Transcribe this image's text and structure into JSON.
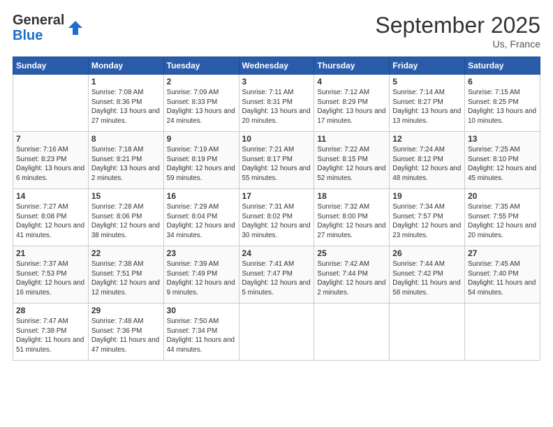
{
  "header": {
    "logo_line1": "General",
    "logo_line2": "Blue",
    "month": "September 2025",
    "location": "Us, France"
  },
  "weekdays": [
    "Sunday",
    "Monday",
    "Tuesday",
    "Wednesday",
    "Thursday",
    "Friday",
    "Saturday"
  ],
  "weeks": [
    [
      {
        "day": "",
        "info": ""
      },
      {
        "day": "1",
        "info": "Sunrise: 7:08 AM\nSunset: 8:36 PM\nDaylight: 13 hours and 27 minutes."
      },
      {
        "day": "2",
        "info": "Sunrise: 7:09 AM\nSunset: 8:33 PM\nDaylight: 13 hours and 24 minutes."
      },
      {
        "day": "3",
        "info": "Sunrise: 7:11 AM\nSunset: 8:31 PM\nDaylight: 13 hours and 20 minutes."
      },
      {
        "day": "4",
        "info": "Sunrise: 7:12 AM\nSunset: 8:29 PM\nDaylight: 13 hours and 17 minutes."
      },
      {
        "day": "5",
        "info": "Sunrise: 7:14 AM\nSunset: 8:27 PM\nDaylight: 13 hours and 13 minutes."
      },
      {
        "day": "6",
        "info": "Sunrise: 7:15 AM\nSunset: 8:25 PM\nDaylight: 13 hours and 10 minutes."
      }
    ],
    [
      {
        "day": "7",
        "info": "Sunrise: 7:16 AM\nSunset: 8:23 PM\nDaylight: 13 hours and 6 minutes."
      },
      {
        "day": "8",
        "info": "Sunrise: 7:18 AM\nSunset: 8:21 PM\nDaylight: 13 hours and 2 minutes."
      },
      {
        "day": "9",
        "info": "Sunrise: 7:19 AM\nSunset: 8:19 PM\nDaylight: 12 hours and 59 minutes."
      },
      {
        "day": "10",
        "info": "Sunrise: 7:21 AM\nSunset: 8:17 PM\nDaylight: 12 hours and 55 minutes."
      },
      {
        "day": "11",
        "info": "Sunrise: 7:22 AM\nSunset: 8:15 PM\nDaylight: 12 hours and 52 minutes."
      },
      {
        "day": "12",
        "info": "Sunrise: 7:24 AM\nSunset: 8:12 PM\nDaylight: 12 hours and 48 minutes."
      },
      {
        "day": "13",
        "info": "Sunrise: 7:25 AM\nSunset: 8:10 PM\nDaylight: 12 hours and 45 minutes."
      }
    ],
    [
      {
        "day": "14",
        "info": "Sunrise: 7:27 AM\nSunset: 8:08 PM\nDaylight: 12 hours and 41 minutes."
      },
      {
        "day": "15",
        "info": "Sunrise: 7:28 AM\nSunset: 8:06 PM\nDaylight: 12 hours and 38 minutes."
      },
      {
        "day": "16",
        "info": "Sunrise: 7:29 AM\nSunset: 8:04 PM\nDaylight: 12 hours and 34 minutes."
      },
      {
        "day": "17",
        "info": "Sunrise: 7:31 AM\nSunset: 8:02 PM\nDaylight: 12 hours and 30 minutes."
      },
      {
        "day": "18",
        "info": "Sunrise: 7:32 AM\nSunset: 8:00 PM\nDaylight: 12 hours and 27 minutes."
      },
      {
        "day": "19",
        "info": "Sunrise: 7:34 AM\nSunset: 7:57 PM\nDaylight: 12 hours and 23 minutes."
      },
      {
        "day": "20",
        "info": "Sunrise: 7:35 AM\nSunset: 7:55 PM\nDaylight: 12 hours and 20 minutes."
      }
    ],
    [
      {
        "day": "21",
        "info": "Sunrise: 7:37 AM\nSunset: 7:53 PM\nDaylight: 12 hours and 16 minutes."
      },
      {
        "day": "22",
        "info": "Sunrise: 7:38 AM\nSunset: 7:51 PM\nDaylight: 12 hours and 12 minutes."
      },
      {
        "day": "23",
        "info": "Sunrise: 7:39 AM\nSunset: 7:49 PM\nDaylight: 12 hours and 9 minutes."
      },
      {
        "day": "24",
        "info": "Sunrise: 7:41 AM\nSunset: 7:47 PM\nDaylight: 12 hours and 5 minutes."
      },
      {
        "day": "25",
        "info": "Sunrise: 7:42 AM\nSunset: 7:44 PM\nDaylight: 12 hours and 2 minutes."
      },
      {
        "day": "26",
        "info": "Sunrise: 7:44 AM\nSunset: 7:42 PM\nDaylight: 11 hours and 58 minutes."
      },
      {
        "day": "27",
        "info": "Sunrise: 7:45 AM\nSunset: 7:40 PM\nDaylight: 11 hours and 54 minutes."
      }
    ],
    [
      {
        "day": "28",
        "info": "Sunrise: 7:47 AM\nSunset: 7:38 PM\nDaylight: 11 hours and 51 minutes."
      },
      {
        "day": "29",
        "info": "Sunrise: 7:48 AM\nSunset: 7:36 PM\nDaylight: 11 hours and 47 minutes."
      },
      {
        "day": "30",
        "info": "Sunrise: 7:50 AM\nSunset: 7:34 PM\nDaylight: 11 hours and 44 minutes."
      },
      {
        "day": "",
        "info": ""
      },
      {
        "day": "",
        "info": ""
      },
      {
        "day": "",
        "info": ""
      },
      {
        "day": "",
        "info": ""
      }
    ]
  ]
}
